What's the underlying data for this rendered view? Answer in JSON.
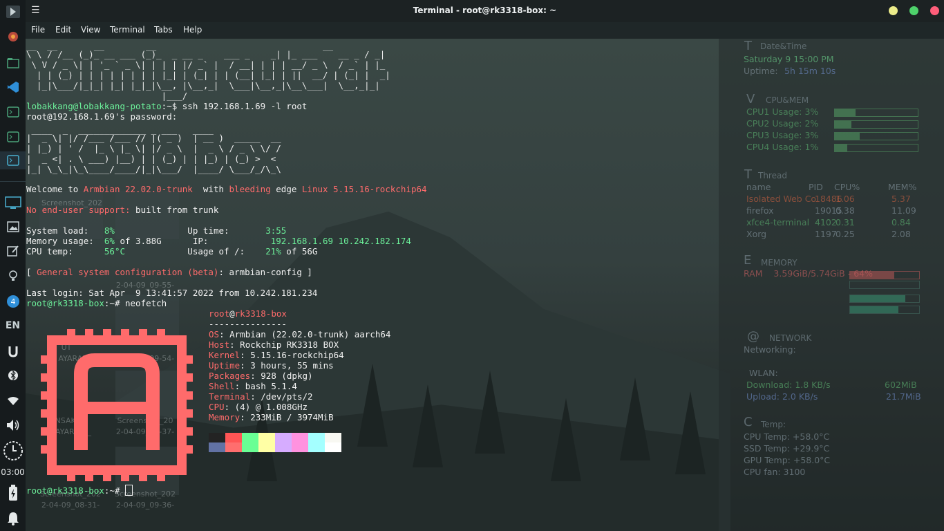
{
  "window": {
    "title": "Terminal - root@rk3318-box: ~"
  },
  "menu": [
    "File",
    "Edit",
    "View",
    "Terminal",
    "Tabs",
    "Help"
  ],
  "dock": {
    "clock": "03:00",
    "lang": "EN",
    "badge": "4",
    "icons": [
      "panel-icon",
      "browser-icon",
      "files-icon",
      "vscode-icon",
      "terminal-icon",
      "terminal-icon",
      "terminal-icon",
      "desktop-icon",
      "image-icon",
      "edit-icon",
      "idea-icon",
      "telegram-icon",
      "keyboard-layout-icon",
      "u-icon",
      "bluetooth-icon",
      "wifi-icon",
      "volume-icon",
      "clock-icon",
      "battery-icon",
      "notification-icon"
    ]
  },
  "terminal": {
    "lines": {
      "ascii1": "__  __       __        __                                __",
      "ascii2": "\\ \\ / /__ (_)_ __ ___ (_)_  _ __ _    ___ _    _| |_ ___    __ _ / _|",
      "ascii3": " \\ V / _ \\| | '_ ` _ \\| | | | |/ _` |  / __| | | | __/ _ \\  / _` | |_",
      "ascii4": "  | | (_) | | | | | | | | |_| | (_| | | (__| |_| | ||  __/ | (_| |  _|",
      "ascii5": "  |_|\\___/|_|_| |_| |_|_|\\__, |\\__,_|  \\___|\\__,_|\\__\\___|  \\__,_|_|",
      "ascii6": "                          |___/",
      "prompt_user": "lobakkang@lobakkang-potato",
      "prompt_rest": ":~$ ssh 192.168.1.69 -l root",
      "password": "root@192.168.1.69's password:",
      "banner1": " ____  _  _____________ _ ___   ____",
      "banner2": "|  _ \\| |/ /___ /___ // |( _ )  | __ )  _____  __",
      "banner3": "| |_) | ' /  |_ \\ |_ \\| |/ _ \\  |  _ \\ / _ \\ \\/ /",
      "banner4": "|  _ <| . \\ ___) |__) | | (_) | | |_) | (_) >  <",
      "banner5": "|_| \\_\\_|\\_\\____/____/|_|\\___/  |____/ \\___/_/\\_\\",
      "welcome_a": "Welcome to ",
      "welcome_b": "Armbian 22.02.0-trunk",
      "welcome_c": "  with ",
      "welcome_d": "bleeding",
      "welcome_e": " edge ",
      "welcome_f": "Linux 5.15.16-rockchip64",
      "support_a": "No end-user support:",
      "support_b": " built from trunk",
      "sys1a": "System load:   ",
      "sys1b": "8%",
      "sys1c": "              Up time:       ",
      "sys1d": "3:55",
      "sys2a": "Memory usage:  ",
      "sys2b": "6%",
      "sys2c": " of 3.88G      IP:            ",
      "sys2d": "192.168.1.69 10.242.182.174",
      "sys3a": "CPU temp:      ",
      "sys3b": "56°C",
      "sys3c": "            Usage of /:    ",
      "sys3d": "21%",
      "sys3e": " of 56G",
      "config_a": "[ ",
      "config_b": "General system configuration (beta)",
      "config_c": ": armbian-config ]",
      "lastlogin": "Last login: Sat Apr  9 13:41:57 2022 from 10.242.181.234",
      "prompt2_user": "root@rk3318-box",
      "prompt2_rest": ":~# neofetch",
      "prompt3_rest": ":~# "
    },
    "neofetch": {
      "user": "root",
      "at": "@",
      "host": "rk3318-box",
      "sep": "---------------",
      "fields": [
        {
          "k": "OS",
          "v": "Armbian (22.02.0-trunk) aarch64"
        },
        {
          "k": "Host",
          "v": "Rockchip RK3318 BOX"
        },
        {
          "k": "Kernel",
          "v": "5.15.16-rockchip64"
        },
        {
          "k": "Uptime",
          "v": "3 hours, 55 mins"
        },
        {
          "k": "Packages",
          "v": "928 (dpkg)"
        },
        {
          "k": "Shell",
          "v": "bash 5.1.4"
        },
        {
          "k": "Terminal",
          "v": "/dev/pts/2"
        },
        {
          "k": "CPU",
          "v": "(4) @ 1.008GHz"
        },
        {
          "k": "Memory",
          "v": "233MiB / 3974MiB"
        }
      ],
      "colors_top": [
        "#232323",
        "#ff5555",
        "#69ff94",
        "#ffffa5",
        "#d6acff",
        "#ff92df",
        "#a4ffff",
        "#f8f8f2"
      ],
      "colors_bottom": [
        "#6272a4",
        "#ff6e6e",
        "#69ff94",
        "#ffffa5",
        "#d6acff",
        "#ff92df",
        "#a4ffff",
        "#ffffff"
      ]
    },
    "desktop_labels": [
      "Screenshot_202",
      "2-04-09_09-55-",
      "UT",
      "AYARAN",
      "2-04-09_09-54-",
      "ANSAKSI",
      "AYARAN _",
      "Screenshot_20",
      "2-04-09_09-37-",
      "Screenshot_202",
      "2-04-09_08-31-",
      "Screenshot_202",
      "2-04-09_09-36-"
    ]
  },
  "conky": {
    "datetime_head": "Date&Time",
    "datetime_value": "Saturday 9 15:00 PM",
    "uptime_label": "Uptime:",
    "uptime_value": "5h 15m 10s",
    "cpumem_head": "CPU&MEM",
    "cpu_rows": [
      "CPU1 Usage: 3%",
      "CPU2 Usage: 2%",
      "CPU3 Usage: 3%",
      "CPU4 Usage: 1%"
    ],
    "cpu_levels": [
      0.25,
      0.2,
      0.3,
      0.15
    ],
    "thread_head": "Thread",
    "thread_cols": [
      "name",
      "PID",
      "CPU%",
      "MEM%"
    ],
    "thread_rows": [
      {
        "name": "Isolated Web Co",
        "pid": "18486",
        "cpu": "1.06",
        "mem": "5.37"
      },
      {
        "name": "firefox",
        "pid": "19015",
        "cpu": "0.38",
        "mem": "11.09"
      },
      {
        "name": "xfce4-terminal",
        "pid": "4102",
        "cpu": "0.31",
        "mem": "0.84"
      },
      {
        "name": "Xorg",
        "pid": "1197",
        "cpu": "0.25",
        "mem": "2.08"
      }
    ],
    "memory_head": "MEMORY",
    "ram_line": "RAM    3.59GiB/5.74GiB - 64%",
    "network_head": "NETWORK",
    "networking": "Networking:",
    "wlan": "WLAN:",
    "download_label": "Download: 1.8 KB/s",
    "download_total": "602MiB",
    "upload_label": "Upload: 2.0 KB/s",
    "upload_total": "21.7MiB",
    "temp_head": "Temp:",
    "temps": [
      "CPU Temp: +58.0°C",
      "SSD Temp: +29.9°C",
      "GPU Temp: +58.0°C",
      "CPU fan: 3100"
    ],
    "glyphs": {
      "t": "T",
      "v": "V",
      "thread": "T",
      "e": "E",
      "at": "@",
      "c": "C"
    }
  },
  "colors": {
    "prompt_green": "#6cf09a",
    "accent_red": "#ff6b6b",
    "logo": "#ff6b6b",
    "close": "#ecec8a",
    "max": "#4ed26b",
    "min": "#ff5e7a"
  }
}
